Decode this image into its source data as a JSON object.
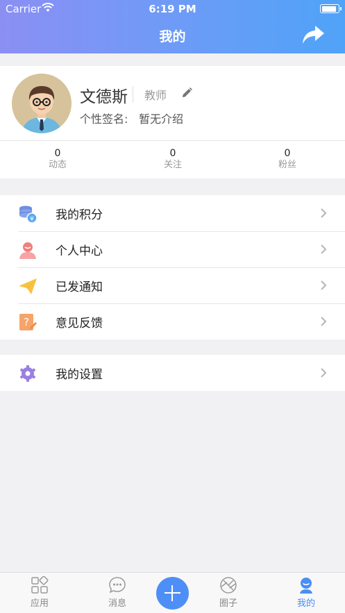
{
  "status_bar": {
    "carrier": "Carrier",
    "time": "6:19 PM"
  },
  "nav": {
    "title": "我的"
  },
  "profile": {
    "name": "文德斯",
    "role": "教师",
    "signature_label": "个性签名:",
    "signature_value": "暂无介绍",
    "stats": [
      {
        "count": "0",
        "label": "动态"
      },
      {
        "count": "0",
        "label": "关注"
      },
      {
        "count": "0",
        "label": "粉丝"
      }
    ]
  },
  "menu": {
    "points": "我的积分",
    "personal_center": "个人中心",
    "sent_notices": "已发通知",
    "feedback": "意见反馈",
    "settings": "我的设置"
  },
  "tabbar": {
    "apps": "应用",
    "messages": "消息",
    "circle": "圈子",
    "mine": "我的"
  },
  "colors": {
    "header_gradient_start": "#8b8ff4",
    "header_gradient_end": "#4fa3f8",
    "accent": "#4d8ff7"
  }
}
